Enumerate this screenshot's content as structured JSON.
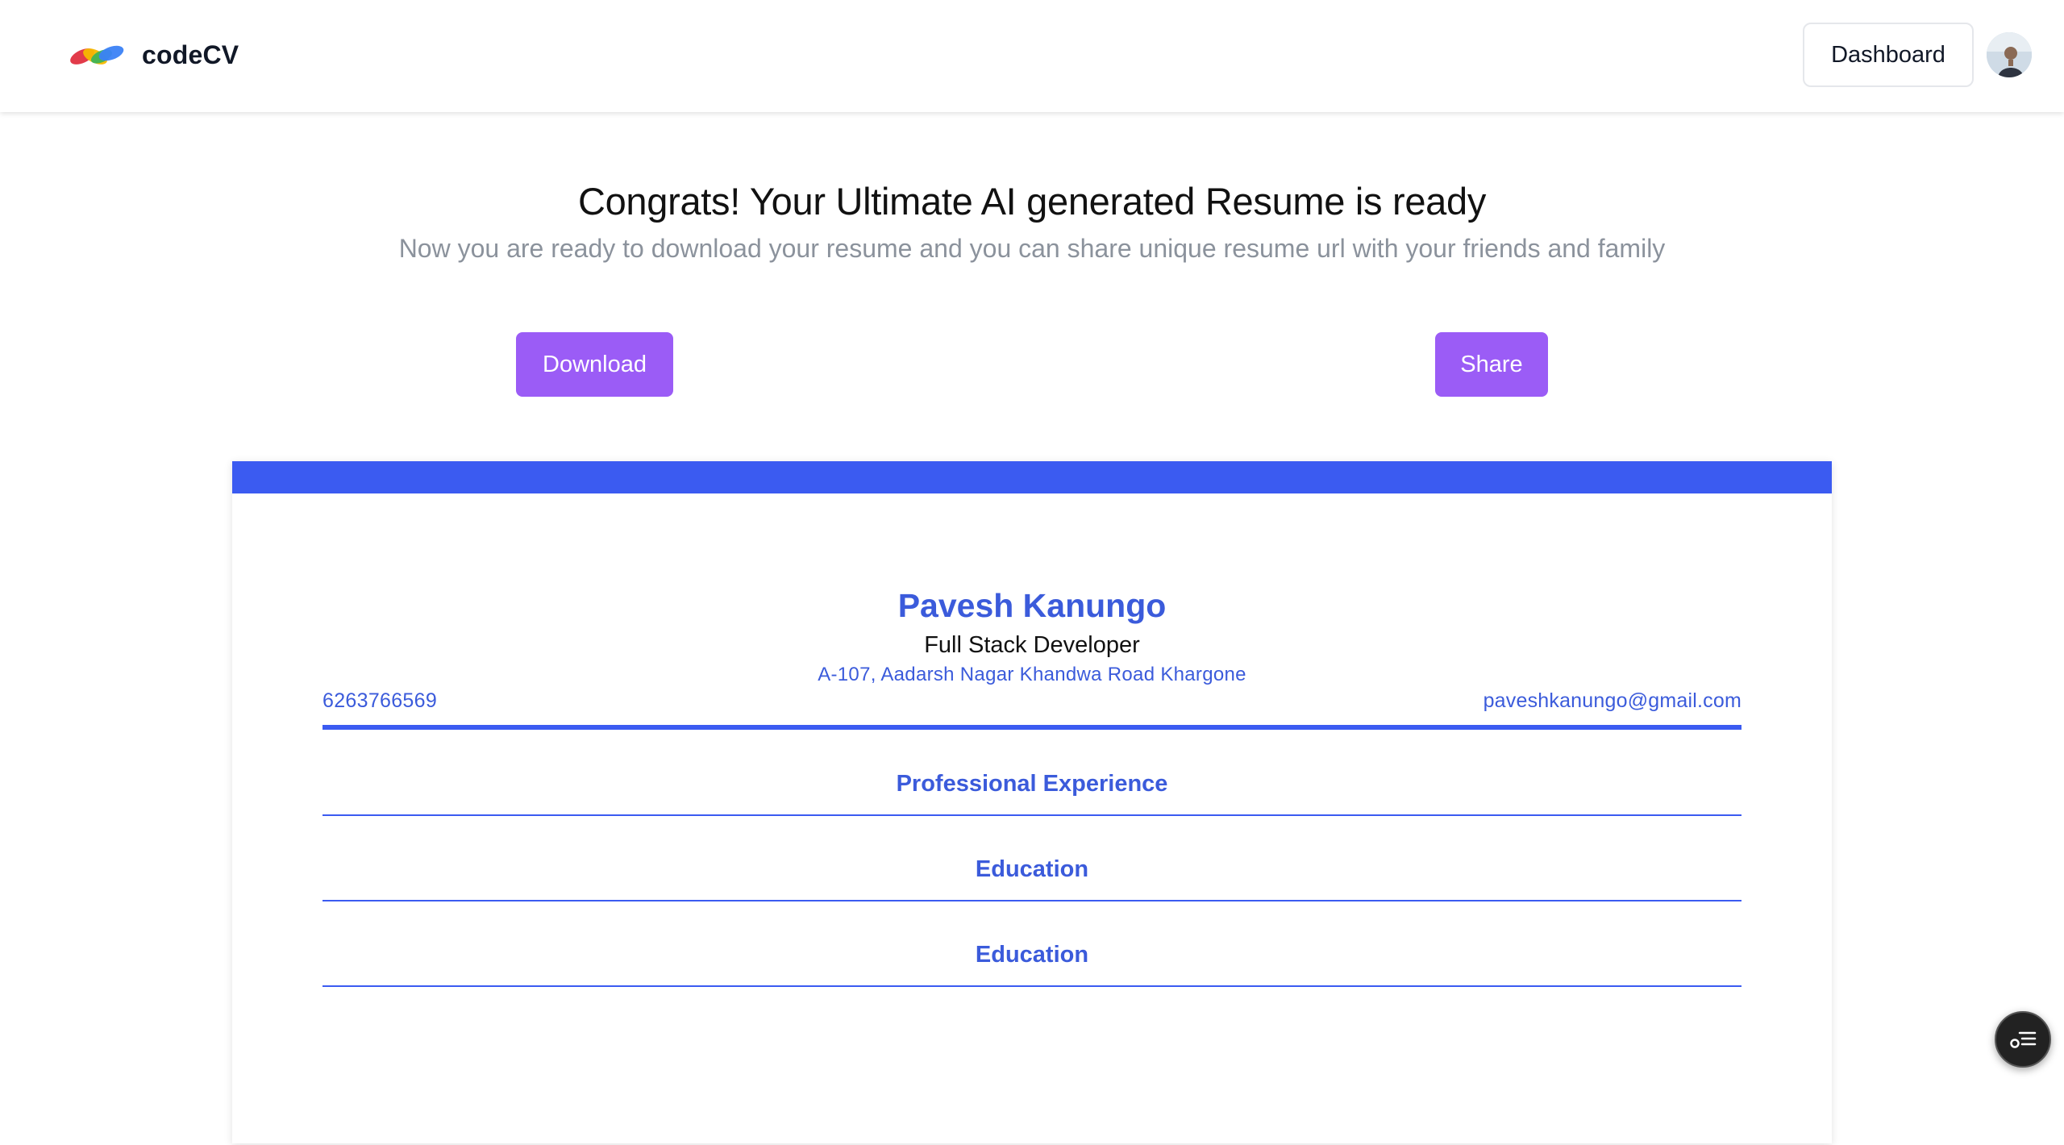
{
  "app": {
    "name": "codeCV"
  },
  "header": {
    "dashboard_label": "Dashboard"
  },
  "hero": {
    "title": "Congrats! Your Ultimate AI generated Resume is ready",
    "subtitle": "Now you are ready to download your resume and you can share unique resume url with your friends and family",
    "download_label": "Download",
    "share_label": "Share"
  },
  "resume": {
    "name": "Pavesh Kanungo",
    "job_title": "Full Stack Developer",
    "address": "A-107, Aadarsh Nagar Khandwa Road Khargone",
    "phone": "6263766569",
    "email": "paveshkanungo@gmail.com",
    "sections": [
      "Professional Experience",
      "Education",
      "Education"
    ]
  },
  "colors": {
    "accent_purple": "#9b5cf6",
    "resume_blue": "#3b5bf1",
    "text_muted": "#8b929c"
  },
  "icons": {
    "logo": "codecv-logo-icon",
    "avatar": "user-avatar",
    "fab": "checklist-icon"
  }
}
